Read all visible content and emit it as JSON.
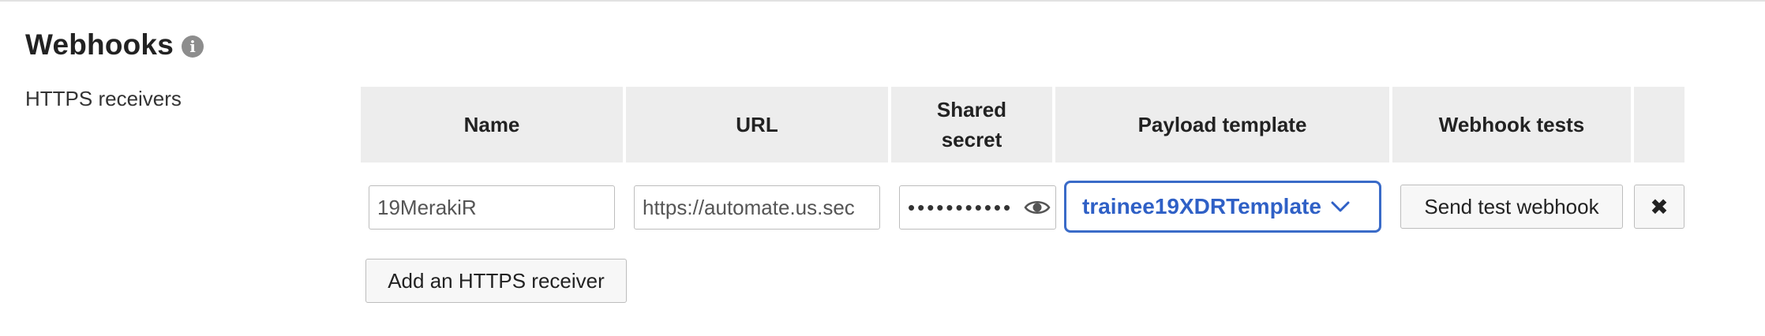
{
  "section": {
    "title": "Webhooks",
    "info_icon": "info-icon",
    "subtitle": "HTTPS receivers"
  },
  "table": {
    "headers": [
      "Name",
      "URL",
      "Shared\nsecret",
      "Payload template",
      "Webhook tests"
    ]
  },
  "row": {
    "name_value": "19MerakiR",
    "url_value": "https://automate.us.sec",
    "secret_masked": "•••••••••••",
    "payload_template": "trainee19XDRTemplate",
    "test_button": "Send test webhook",
    "remove_icon": "close-icon"
  },
  "add_button": "Add an HTTPS receiver",
  "colors": {
    "header_bg": "#ededed",
    "select_accent": "#3a6bc8",
    "select_text": "#2f60c6"
  }
}
